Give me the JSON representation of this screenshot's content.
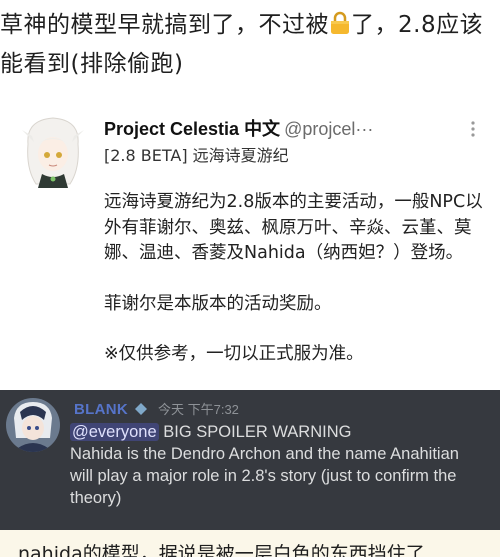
{
  "post": {
    "line1_a": "草神的模型早就搞到了，不过被",
    "line1_b": "了，2.8应该",
    "line2": "能看到(排除偷跑)"
  },
  "tweet": {
    "name": "Project Celestia 中文",
    "handle": "@projcel···",
    "subtitle": "[2.8 BETA] 远海诗夏游纪",
    "para1": "远海诗夏游纪为2.8版本的主要活动，一般NPC以外有菲谢尔、奥兹、枫原万叶、辛焱、云堇、莫娜、温迪、香菱及Nahida（纳西妲？）登场。",
    "para2": "菲谢尔是本版本的活动奖励。",
    "para3": "※仅供参考，一切以正式服为准。"
  },
  "discord": {
    "username": "BLANK",
    "timestamp": "今天 下午7:32",
    "mention": "@everyone",
    "line1_rest": " BIG SPOILER WARNING",
    "line2": "Nahida is the Dendro Archon and the name Anahitian",
    "line3": "will play a major role in 2.8's story (just to confirm the",
    "line4": "theory)"
  },
  "bottom": {
    "text": "nahida的模型，据说是被一层白色的东西挡住了"
  },
  "colors": {
    "discord_bg": "#36393f",
    "mention_bg": "#4d5596",
    "username": "#5a7bd8",
    "lock": "#f5b82e",
    "bottom_strip": "#fbf7e9"
  },
  "icons": [
    "lock-icon",
    "more-vertical-icon",
    "bot-badge-icon"
  ]
}
